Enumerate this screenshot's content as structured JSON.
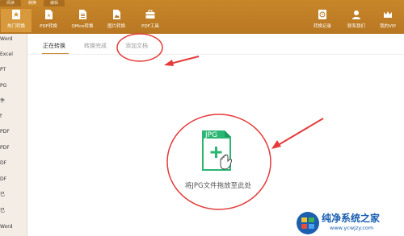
{
  "toolbar": {
    "tabs": [
      "阅读",
      "转换",
      "编辑"
    ],
    "left_buttons": [
      {
        "label": "热门转换",
        "icon": "star-icon"
      },
      {
        "label": "PDF转换",
        "icon": "pdf-file-icon"
      },
      {
        "label": "Office转换",
        "icon": "office-file-icon"
      },
      {
        "label": "图片转换",
        "icon": "image-file-icon"
      },
      {
        "label": "PDF工具",
        "icon": "toolbox-icon"
      }
    ],
    "right_buttons": [
      {
        "label": "转换记录",
        "icon": "history-icon"
      },
      {
        "label": "联系我们",
        "icon": "contact-icon"
      },
      {
        "label": "我的VIP",
        "icon": "crown-icon"
      }
    ],
    "accent_color": "#c8862a"
  },
  "sidebar": {
    "items": [
      "Word",
      "Excel",
      "PT",
      "PG",
      "件",
      "f",
      "PDF",
      "PDF",
      "DF",
      "DF",
      "已",
      "已",
      "Word"
    ]
  },
  "content": {
    "tabs": [
      "正在转换",
      "转换完成",
      "添加文档"
    ],
    "active_tab": "正在转换"
  },
  "drop_zone": {
    "file_type": "JPG",
    "caption": "将JPG文件拖放至此处"
  },
  "watermark": {
    "title": "纯净系统之家",
    "url": "www.ycwjzy.com"
  }
}
